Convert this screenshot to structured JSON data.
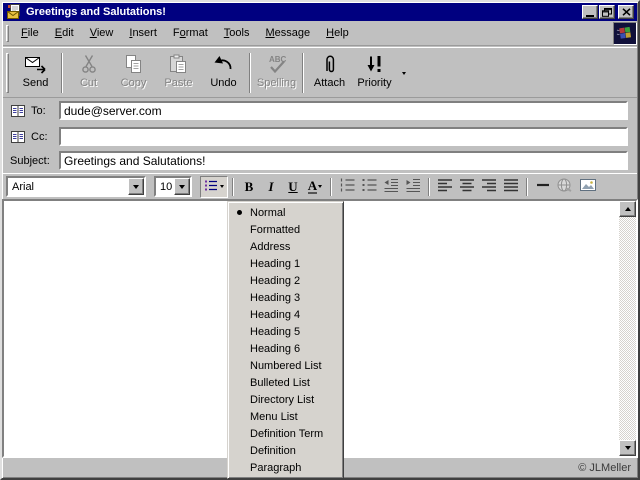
{
  "window": {
    "title": "Greetings and Salutations!",
    "icon": "new-message-icon",
    "controls": [
      "minimize",
      "restore",
      "close"
    ]
  },
  "menu_bar": {
    "items": [
      {
        "label": "File",
        "mnemonic": "F"
      },
      {
        "label": "Edit",
        "mnemonic": "E"
      },
      {
        "label": "View",
        "mnemonic": "V"
      },
      {
        "label": "Insert",
        "mnemonic": "I"
      },
      {
        "label": "Format",
        "mnemonic": "o"
      },
      {
        "label": "Tools",
        "mnemonic": "T"
      },
      {
        "label": "Message",
        "mnemonic": "M"
      },
      {
        "label": "Help",
        "mnemonic": "H"
      }
    ],
    "logo": "windows-logo"
  },
  "toolbar": {
    "buttons": [
      {
        "label": "Send",
        "icon": "send-icon",
        "enabled": true
      },
      {
        "separator": true
      },
      {
        "label": "Cut",
        "icon": "cut-icon",
        "enabled": false
      },
      {
        "label": "Copy",
        "icon": "copy-icon",
        "enabled": false
      },
      {
        "label": "Paste",
        "icon": "paste-icon",
        "enabled": false
      },
      {
        "label": "Undo",
        "icon": "undo-icon",
        "enabled": true
      },
      {
        "separator": true
      },
      {
        "label": "Spelling",
        "icon": "spelling-icon",
        "enabled": false
      },
      {
        "separator": true
      },
      {
        "label": "Attach",
        "icon": "attach-icon",
        "enabled": true
      },
      {
        "label": "Priority",
        "icon": "priority-icon",
        "enabled": true
      },
      {
        "overflow": true
      }
    ]
  },
  "headers": {
    "to": {
      "label": "To:",
      "value": "dude@server.com",
      "icon": "address-book-icon"
    },
    "cc": {
      "label": "Cc:",
      "value": "",
      "icon": "address-book-icon"
    },
    "subject": {
      "label": "Subject:",
      "value": "Greetings and Salutations!"
    }
  },
  "format_toolbar": {
    "font_name": "Arial",
    "font_size": "10",
    "bold_label": "B",
    "italic_label": "I",
    "underline_label": "U",
    "color_label": "A"
  },
  "style_menu": {
    "selected": "Normal",
    "items": [
      "Normal",
      "Formatted",
      "Address",
      "Heading 1",
      "Heading 2",
      "Heading 3",
      "Heading 4",
      "Heading 5",
      "Heading 6",
      "Numbered List",
      "Bulleted List",
      "Directory List",
      "Menu List",
      "Definition Term",
      "Definition",
      "Paragraph"
    ]
  },
  "body": {
    "content": ""
  },
  "status_bar": {
    "credit": "© JLMeller"
  },
  "colors": {
    "titlebar": "#000080",
    "chrome": "#c0c0c0",
    "disabled_text": "#848484",
    "field_bg": "#ffffff"
  }
}
